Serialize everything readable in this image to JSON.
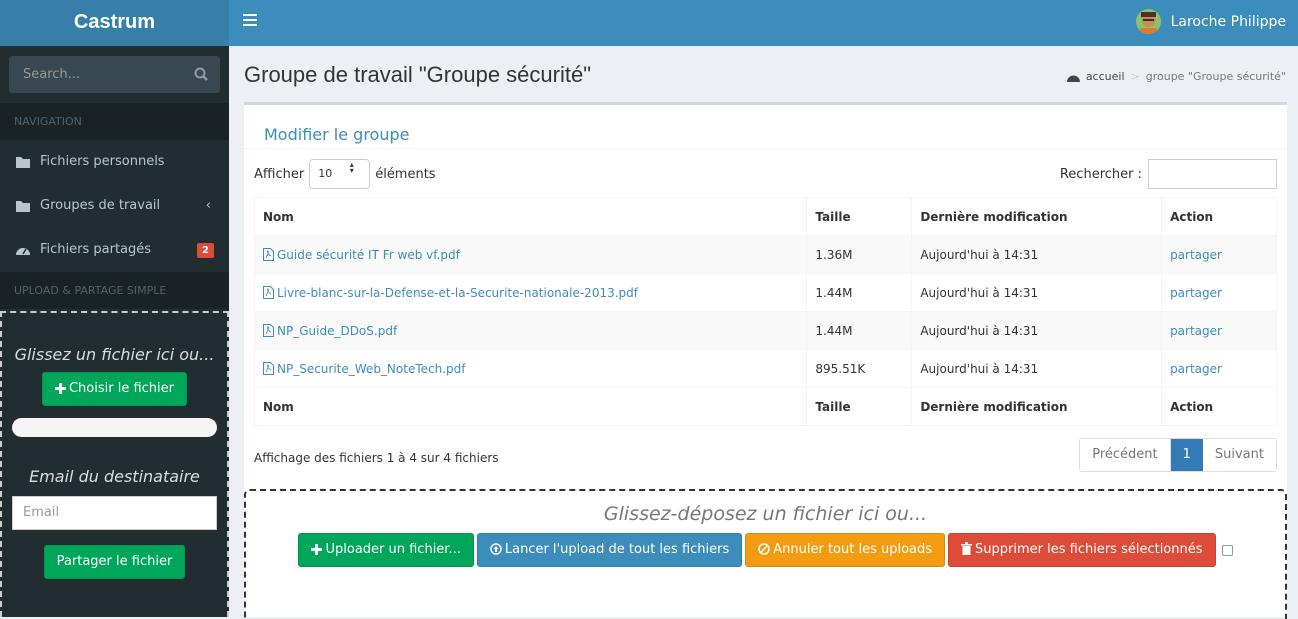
{
  "app": {
    "title": "Castrum"
  },
  "user": {
    "name": "Laroche Philippe"
  },
  "sidebar": {
    "search_placeholder": "Search...",
    "nav_header": "NAVIGATION",
    "items": [
      {
        "label": "Fichiers personnels",
        "icon": "folder-icon"
      },
      {
        "label": "Groupes de travail",
        "icon": "folder-icon"
      },
      {
        "label": "Fichiers partagés",
        "icon": "dashboard-icon",
        "badge": "2"
      }
    ],
    "upload_header": "UPLOAD & PARTAGE SIMPLE",
    "drop_text": "Glissez un fichier ici ou...",
    "choose_button": "Choisir le fichier",
    "email_title": "Email du destinataire",
    "email_placeholder": "Email",
    "share_button": "Partager le fichier"
  },
  "page": {
    "title": "Groupe de travail \"Groupe sécurité\"",
    "breadcrumb": [
      "accueil",
      "groupe \"Groupe sécurité\""
    ]
  },
  "box": {
    "title": "Modifier le groupe",
    "show_label": "Afficher",
    "show_value": "10",
    "show_suffix": "éléments",
    "search_label": "Rechercher :",
    "columns": [
      "Nom",
      "Taille",
      "Dernière modification",
      "Action"
    ],
    "rows": [
      {
        "name": "Guide sécurité IT Fr web vf.pdf",
        "size": "1.36M",
        "modified": "Aujourd'hui à 14:31",
        "action": "partager"
      },
      {
        "name": "Livre-blanc-sur-la-Defense-et-la-Securite-nationale-2013.pdf",
        "size": "1.44M",
        "modified": "Aujourd'hui à 14:31",
        "action": "partager"
      },
      {
        "name": "NP_Guide_DDoS.pdf",
        "size": "1.44M",
        "modified": "Aujourd'hui à 14:31",
        "action": "partager"
      },
      {
        "name": "NP_Securite_Web_NoteTech.pdf",
        "size": "895.51K",
        "modified": "Aujourd'hui à 14:31",
        "action": "partager"
      }
    ],
    "info": "Affichage des fichiers 1 à 4 sur 4 fichiers",
    "pagination": {
      "prev": "Précédent",
      "current": "1",
      "next": "Suivant"
    }
  },
  "dropzone": {
    "text": "Glissez-déposez un fichier ici ou...",
    "upload": "Uploader un fichier...",
    "start_all": "Lancer l'upload de tout les fichiers",
    "cancel_all": "Annuler tout les uploads",
    "delete_selected": "Supprimer les fichiers sélectionnés"
  },
  "colors": {
    "primary": "#3c8dbc",
    "success": "#00a65a",
    "warning": "#f39c12",
    "danger": "#dd4b39",
    "sidebar": "#222d32"
  }
}
